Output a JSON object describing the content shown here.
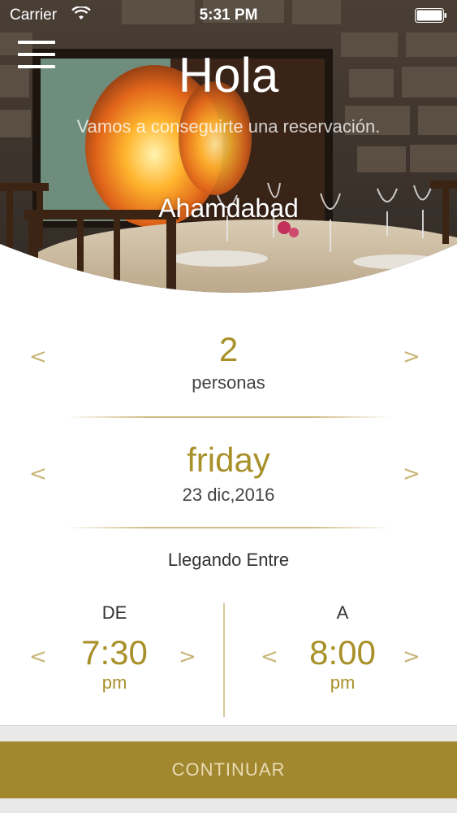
{
  "status_bar": {
    "carrier": "Carrier",
    "time": "5:31 PM"
  },
  "header": {
    "title": "Hola",
    "subtitle": "Vamos a conseguirte una reservación.",
    "location": "Ahamdabad"
  },
  "guests": {
    "count": "2",
    "label": "personas"
  },
  "date": {
    "weekday": "friday",
    "full_date": "23 dic,2016"
  },
  "arrival": {
    "label": "Llegando Entre",
    "from": {
      "label": "DE",
      "time": "7:30",
      "ampm": "pm"
    },
    "to": {
      "label": "A",
      "time": "8:00",
      "ampm": "pm"
    }
  },
  "arrows": {
    "prev": "<",
    "next": ">"
  },
  "continue_button": {
    "label": "CONTINUAR"
  },
  "colors": {
    "accent": "#a8902a",
    "button": "#a1872d",
    "button_text": "#e9dcb6"
  },
  "icons": {
    "menu": "hamburger-menu-icon",
    "wifi": "wifi-icon",
    "battery": "battery-icon"
  }
}
